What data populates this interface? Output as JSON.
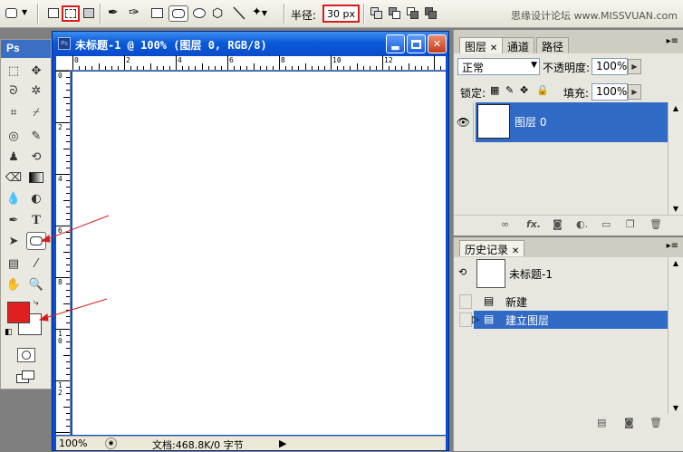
{
  "options_bar": {
    "radius_label": "半径:",
    "radius_value": "30 px",
    "watermark": "思缘设计论坛 www.MISSVUAN.com"
  },
  "toolbox": {
    "logo": "Ps",
    "foreground_color": "#e02020",
    "background_color": "#ffffff"
  },
  "document": {
    "title": "未标题-1 @ 100% (图层 0, RGB/8)",
    "zoom": "100%",
    "doc_info": "文档:468.8K/0 字节",
    "ruler_top_labels": [
      "0",
      "2",
      "4",
      "6",
      "8",
      "10",
      "12"
    ],
    "ruler_left_labels": [
      "0",
      "2",
      "4",
      "6",
      "8",
      "1\n0",
      "1\n2"
    ]
  },
  "layers_panel": {
    "tabs": [
      "图层",
      "通道",
      "路径"
    ],
    "blend_mode": "正常",
    "opacity_label": "不透明度:",
    "opacity_value": "100%",
    "lock_label": "锁定:",
    "fill_label": "填充:",
    "fill_value": "100%",
    "layers": [
      {
        "name": "图层 0"
      }
    ]
  },
  "history_panel": {
    "tab": "历史记录",
    "snapshot_name": "未标题-1",
    "items": [
      {
        "label": "新建"
      },
      {
        "label": "建立图层"
      }
    ]
  }
}
